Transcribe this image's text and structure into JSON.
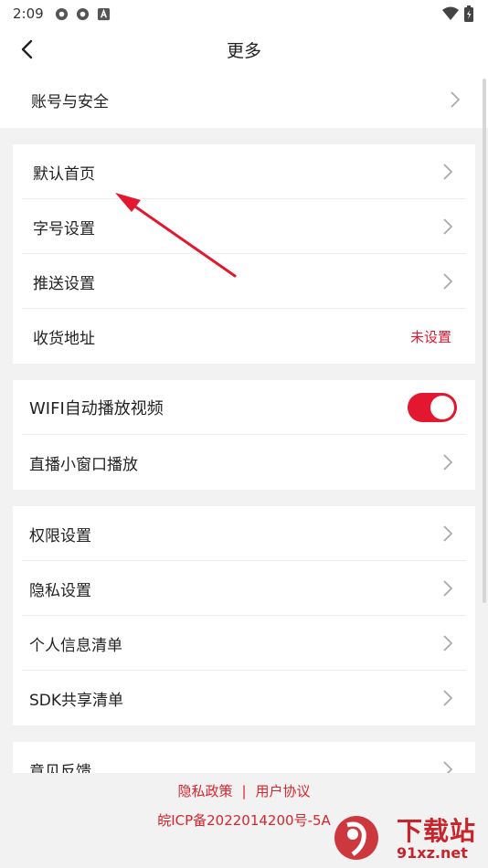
{
  "status_bar": {
    "time": "2:09"
  },
  "header": {
    "title": "更多"
  },
  "account": {
    "label": "账号与安全"
  },
  "group1": {
    "items": [
      {
        "label": "默认首页"
      },
      {
        "label": "字号设置"
      },
      {
        "label": "推送设置"
      },
      {
        "label": "收货地址",
        "value": "未设置"
      }
    ]
  },
  "group2": {
    "wifi": {
      "label": "WIFI自动播放视频",
      "toggle": "on"
    },
    "live": {
      "label": "直播小窗口播放"
    }
  },
  "group3": {
    "items": [
      {
        "label": "权限设置"
      },
      {
        "label": "隐私设置"
      },
      {
        "label": "个人信息清单"
      },
      {
        "label": "SDK共享清单"
      }
    ]
  },
  "group4": {
    "items": [
      {
        "label": "意见反馈"
      }
    ]
  },
  "footer": {
    "privacy": "隐私政策",
    "separator": "|",
    "agreement": "用户协议",
    "icp": "皖ICP备2022014200号-5A"
  },
  "watermark": {
    "line1": "下载站",
    "line2": "91xz.net"
  },
  "colors": {
    "accent": "#e3172f",
    "background": "#f2f2f2"
  }
}
